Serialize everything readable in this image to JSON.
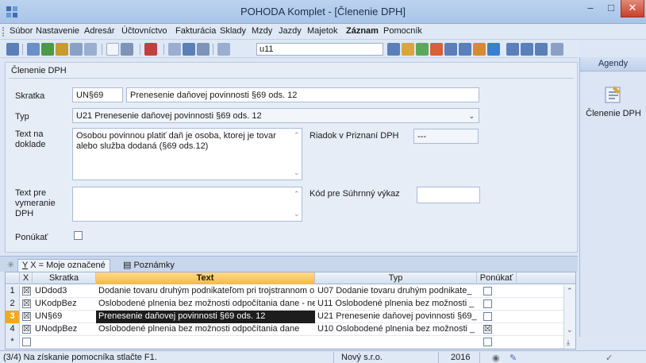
{
  "window": {
    "title": "POHODA Komplet - [Členenie DPH]",
    "min_glyph": "–",
    "max_glyph": "□",
    "close_glyph": "✕"
  },
  "menu": [
    "Súbor",
    "Nastavenie",
    "Adresár",
    "Účtovníctvo",
    "Fakturácia",
    "Sklady",
    "Mzdy",
    "Jazdy",
    "Majetok",
    "Záznam",
    "Pomocník"
  ],
  "toolbar": {
    "search_value": "u11",
    "icon_colors": [
      "#5b7fb8",
      "#6a8fc9",
      "#4a9a4a",
      "#c89b2e",
      "#8aa0c4",
      "#9aaed0",
      "#7d93b8",
      "#c04040",
      "#9aaed0",
      "#5b7fb8",
      "#7d93b8",
      "#9aaed0"
    ],
    "icon_colors_right": [
      "#5b7fb8",
      "#d9a63a",
      "#5ba85b",
      "#d96030",
      "#5b7fb8",
      "#5b7fb8",
      "#d98a30",
      "#3a7fd0",
      "#5b7fb8",
      "#5b7fb8",
      "#5b7fb8",
      "#8aa0c4"
    ]
  },
  "agendy": {
    "header": "Agendy",
    "item_label": "Členenie DPH"
  },
  "form": {
    "title": "Členenie DPH",
    "skratka_label": "Skratka",
    "skratka_code": "UN§69",
    "skratka_desc": "Prenesenie daňovej povinnosti §69 ods. 12",
    "typ_label": "Typ",
    "typ_value": "U21 Prenesenie daňovej povinnosti §69 ods. 12",
    "text_na_doklade_label": "Text na doklade",
    "text_na_doklade_value": "Osobou povinnou platiť daň je osoba, ktorej je tovar alebo služba dodaná (§69 ods.12)",
    "riadok_label": "Riadok v Priznaní DPH",
    "riadok_value": "---",
    "text_pre_vymeranie_label": "Text pre vymeranie DPH",
    "text_pre_vymeranie_value": "",
    "kod_label": "Kód pre Súhrnný výkaz",
    "kod_value": "",
    "ponukat_label": "Ponúkať"
  },
  "tabs": {
    "filter_tab": "X = Moje označené",
    "notes_tab": "Poznámky"
  },
  "grid": {
    "headers": {
      "x": "X",
      "skratka": "Skratka",
      "text": "Text",
      "typ": "Typ",
      "ponukat": "Ponúkať"
    },
    "rows": [
      {
        "num": "1",
        "x": "☒",
        "skratka": "UDdod3",
        "text": "Dodanie tovaru druhým podnikateľom pri trojstrannom obchode",
        "typ": "U07 Dodanie tovaru druhým podnikate_",
        "ponukat": ""
      },
      {
        "num": "2",
        "x": "☒",
        "skratka": "UKodpBez",
        "text": "Oslobodené plnenia bez možnosti odpočítania dane - nezapočíta_",
        "typ": "U11 Oslobodené plnenia bez možnosti _",
        "ponukat": ""
      },
      {
        "num": "3",
        "x": "☒",
        "skratka": "UN§69",
        "text": "Prenesenie daňovej povinnosti §69 ods. 12",
        "typ": "U21 Prenesenie daňovej povinnosti §69_",
        "ponukat": ""
      },
      {
        "num": "4",
        "x": "☒",
        "skratka": "UNodpBez",
        "text": "Oslobodené plnenia bez možnosti odpočítania dane",
        "typ": "U10 Oslobodené plnenia bez možnosti _",
        "ponukat": "☒"
      },
      {
        "num": "*",
        "x": "",
        "skratka": "",
        "text": "",
        "typ": "",
        "ponukat": ""
      }
    ]
  },
  "status": {
    "hint": "(3/4) Na získanie pomocníka stlačte F1.",
    "company": "Nový s.r.o.",
    "year": "2016"
  }
}
